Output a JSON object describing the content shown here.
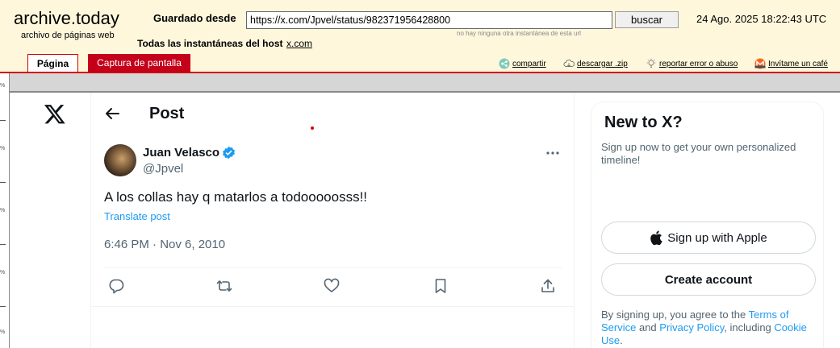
{
  "archive": {
    "brand": "archive.today",
    "tagline": "archivo de páginas web",
    "saved_from_label": "Guardado desde",
    "url_value": "https://x.com/Jpvel/status/982371956428800",
    "search_button": "buscar",
    "no_snapshot_note": "no hay ninguna otra instantánea de esta url",
    "archived_date": "24 Ago. 2025 18:22:43 UTC",
    "all_snapshots_label": "Todas las instantáneas  del host",
    "host_link": "x.com",
    "tabs": {
      "page": "Página",
      "screenshot": "Captura de pantalla"
    },
    "links": {
      "share": "compartir",
      "download": "descargar .zip",
      "report": "reportar error o abuso",
      "coffee": "Invítame un café"
    },
    "ruler_marks": [
      "%",
      "%",
      "%",
      "%",
      "%",
      "%"
    ]
  },
  "x_page": {
    "header_title": "Post",
    "author": {
      "name": "Juan Velasco",
      "handle": "@Jpvel",
      "verified": true
    },
    "tweet_text": "A los collas hay q matarlos a todooooosss!!",
    "translate_link": "Translate post",
    "timestamp": "6:46 PM · Nov 6, 2010",
    "actions": [
      "reply-icon",
      "retweet-icon",
      "like-icon",
      "bookmark-icon",
      "share-icon"
    ]
  },
  "sidebar": {
    "title": "New to X?",
    "subtitle": "Sign up now to get your own personalized timeline!",
    "apple_button": "Sign up with Apple",
    "create_button": "Create account",
    "terms": {
      "prefix": "By signing up, you agree to the ",
      "terms_link": "Terms of Service",
      "and": " and ",
      "privacy_link": "Privacy Policy",
      "including": ", including ",
      "cookie_link": "Cookie Use",
      "suffix": "."
    }
  },
  "colors": {
    "archive_bg": "#fff7dc",
    "archive_red": "#c4001a",
    "x_text": "#0f1419",
    "x_muted": "#536471",
    "x_blue": "#1d9bf0"
  }
}
